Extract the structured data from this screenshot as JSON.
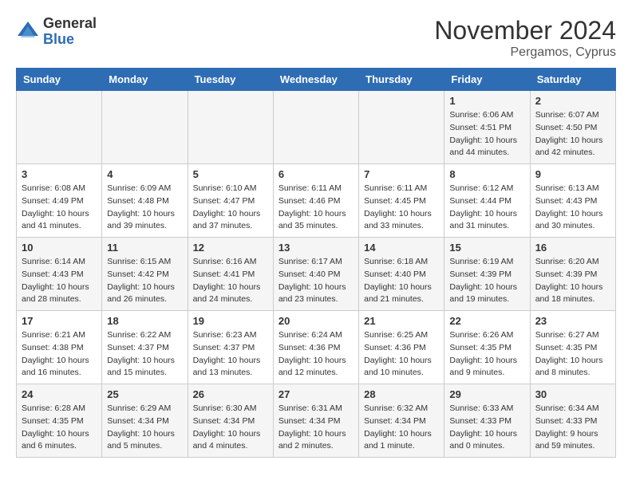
{
  "logo": {
    "general": "General",
    "blue": "Blue"
  },
  "title": "November 2024",
  "location": "Pergamos, Cyprus",
  "days_of_week": [
    "Sunday",
    "Monday",
    "Tuesday",
    "Wednesday",
    "Thursday",
    "Friday",
    "Saturday"
  ],
  "weeks": [
    [
      {
        "day": "",
        "info": ""
      },
      {
        "day": "",
        "info": ""
      },
      {
        "day": "",
        "info": ""
      },
      {
        "day": "",
        "info": ""
      },
      {
        "day": "",
        "info": ""
      },
      {
        "day": "1",
        "info": "Sunrise: 6:06 AM\nSunset: 4:51 PM\nDaylight: 10 hours\nand 44 minutes."
      },
      {
        "day": "2",
        "info": "Sunrise: 6:07 AM\nSunset: 4:50 PM\nDaylight: 10 hours\nand 42 minutes."
      }
    ],
    [
      {
        "day": "3",
        "info": "Sunrise: 6:08 AM\nSunset: 4:49 PM\nDaylight: 10 hours\nand 41 minutes."
      },
      {
        "day": "4",
        "info": "Sunrise: 6:09 AM\nSunset: 4:48 PM\nDaylight: 10 hours\nand 39 minutes."
      },
      {
        "day": "5",
        "info": "Sunrise: 6:10 AM\nSunset: 4:47 PM\nDaylight: 10 hours\nand 37 minutes."
      },
      {
        "day": "6",
        "info": "Sunrise: 6:11 AM\nSunset: 4:46 PM\nDaylight: 10 hours\nand 35 minutes."
      },
      {
        "day": "7",
        "info": "Sunrise: 6:11 AM\nSunset: 4:45 PM\nDaylight: 10 hours\nand 33 minutes."
      },
      {
        "day": "8",
        "info": "Sunrise: 6:12 AM\nSunset: 4:44 PM\nDaylight: 10 hours\nand 31 minutes."
      },
      {
        "day": "9",
        "info": "Sunrise: 6:13 AM\nSunset: 4:43 PM\nDaylight: 10 hours\nand 30 minutes."
      }
    ],
    [
      {
        "day": "10",
        "info": "Sunrise: 6:14 AM\nSunset: 4:43 PM\nDaylight: 10 hours\nand 28 minutes."
      },
      {
        "day": "11",
        "info": "Sunrise: 6:15 AM\nSunset: 4:42 PM\nDaylight: 10 hours\nand 26 minutes."
      },
      {
        "day": "12",
        "info": "Sunrise: 6:16 AM\nSunset: 4:41 PM\nDaylight: 10 hours\nand 24 minutes."
      },
      {
        "day": "13",
        "info": "Sunrise: 6:17 AM\nSunset: 4:40 PM\nDaylight: 10 hours\nand 23 minutes."
      },
      {
        "day": "14",
        "info": "Sunrise: 6:18 AM\nSunset: 4:40 PM\nDaylight: 10 hours\nand 21 minutes."
      },
      {
        "day": "15",
        "info": "Sunrise: 6:19 AM\nSunset: 4:39 PM\nDaylight: 10 hours\nand 19 minutes."
      },
      {
        "day": "16",
        "info": "Sunrise: 6:20 AM\nSunset: 4:39 PM\nDaylight: 10 hours\nand 18 minutes."
      }
    ],
    [
      {
        "day": "17",
        "info": "Sunrise: 6:21 AM\nSunset: 4:38 PM\nDaylight: 10 hours\nand 16 minutes."
      },
      {
        "day": "18",
        "info": "Sunrise: 6:22 AM\nSunset: 4:37 PM\nDaylight: 10 hours\nand 15 minutes."
      },
      {
        "day": "19",
        "info": "Sunrise: 6:23 AM\nSunset: 4:37 PM\nDaylight: 10 hours\nand 13 minutes."
      },
      {
        "day": "20",
        "info": "Sunrise: 6:24 AM\nSunset: 4:36 PM\nDaylight: 10 hours\nand 12 minutes."
      },
      {
        "day": "21",
        "info": "Sunrise: 6:25 AM\nSunset: 4:36 PM\nDaylight: 10 hours\nand 10 minutes."
      },
      {
        "day": "22",
        "info": "Sunrise: 6:26 AM\nSunset: 4:35 PM\nDaylight: 10 hours\nand 9 minutes."
      },
      {
        "day": "23",
        "info": "Sunrise: 6:27 AM\nSunset: 4:35 PM\nDaylight: 10 hours\nand 8 minutes."
      }
    ],
    [
      {
        "day": "24",
        "info": "Sunrise: 6:28 AM\nSunset: 4:35 PM\nDaylight: 10 hours\nand 6 minutes."
      },
      {
        "day": "25",
        "info": "Sunrise: 6:29 AM\nSunset: 4:34 PM\nDaylight: 10 hours\nand 5 minutes."
      },
      {
        "day": "26",
        "info": "Sunrise: 6:30 AM\nSunset: 4:34 PM\nDaylight: 10 hours\nand 4 minutes."
      },
      {
        "day": "27",
        "info": "Sunrise: 6:31 AM\nSunset: 4:34 PM\nDaylight: 10 hours\nand 2 minutes."
      },
      {
        "day": "28",
        "info": "Sunrise: 6:32 AM\nSunset: 4:34 PM\nDaylight: 10 hours\nand 1 minute."
      },
      {
        "day": "29",
        "info": "Sunrise: 6:33 AM\nSunset: 4:33 PM\nDaylight: 10 hours\nand 0 minutes."
      },
      {
        "day": "30",
        "info": "Sunrise: 6:34 AM\nSunset: 4:33 PM\nDaylight: 9 hours\nand 59 minutes."
      }
    ]
  ]
}
